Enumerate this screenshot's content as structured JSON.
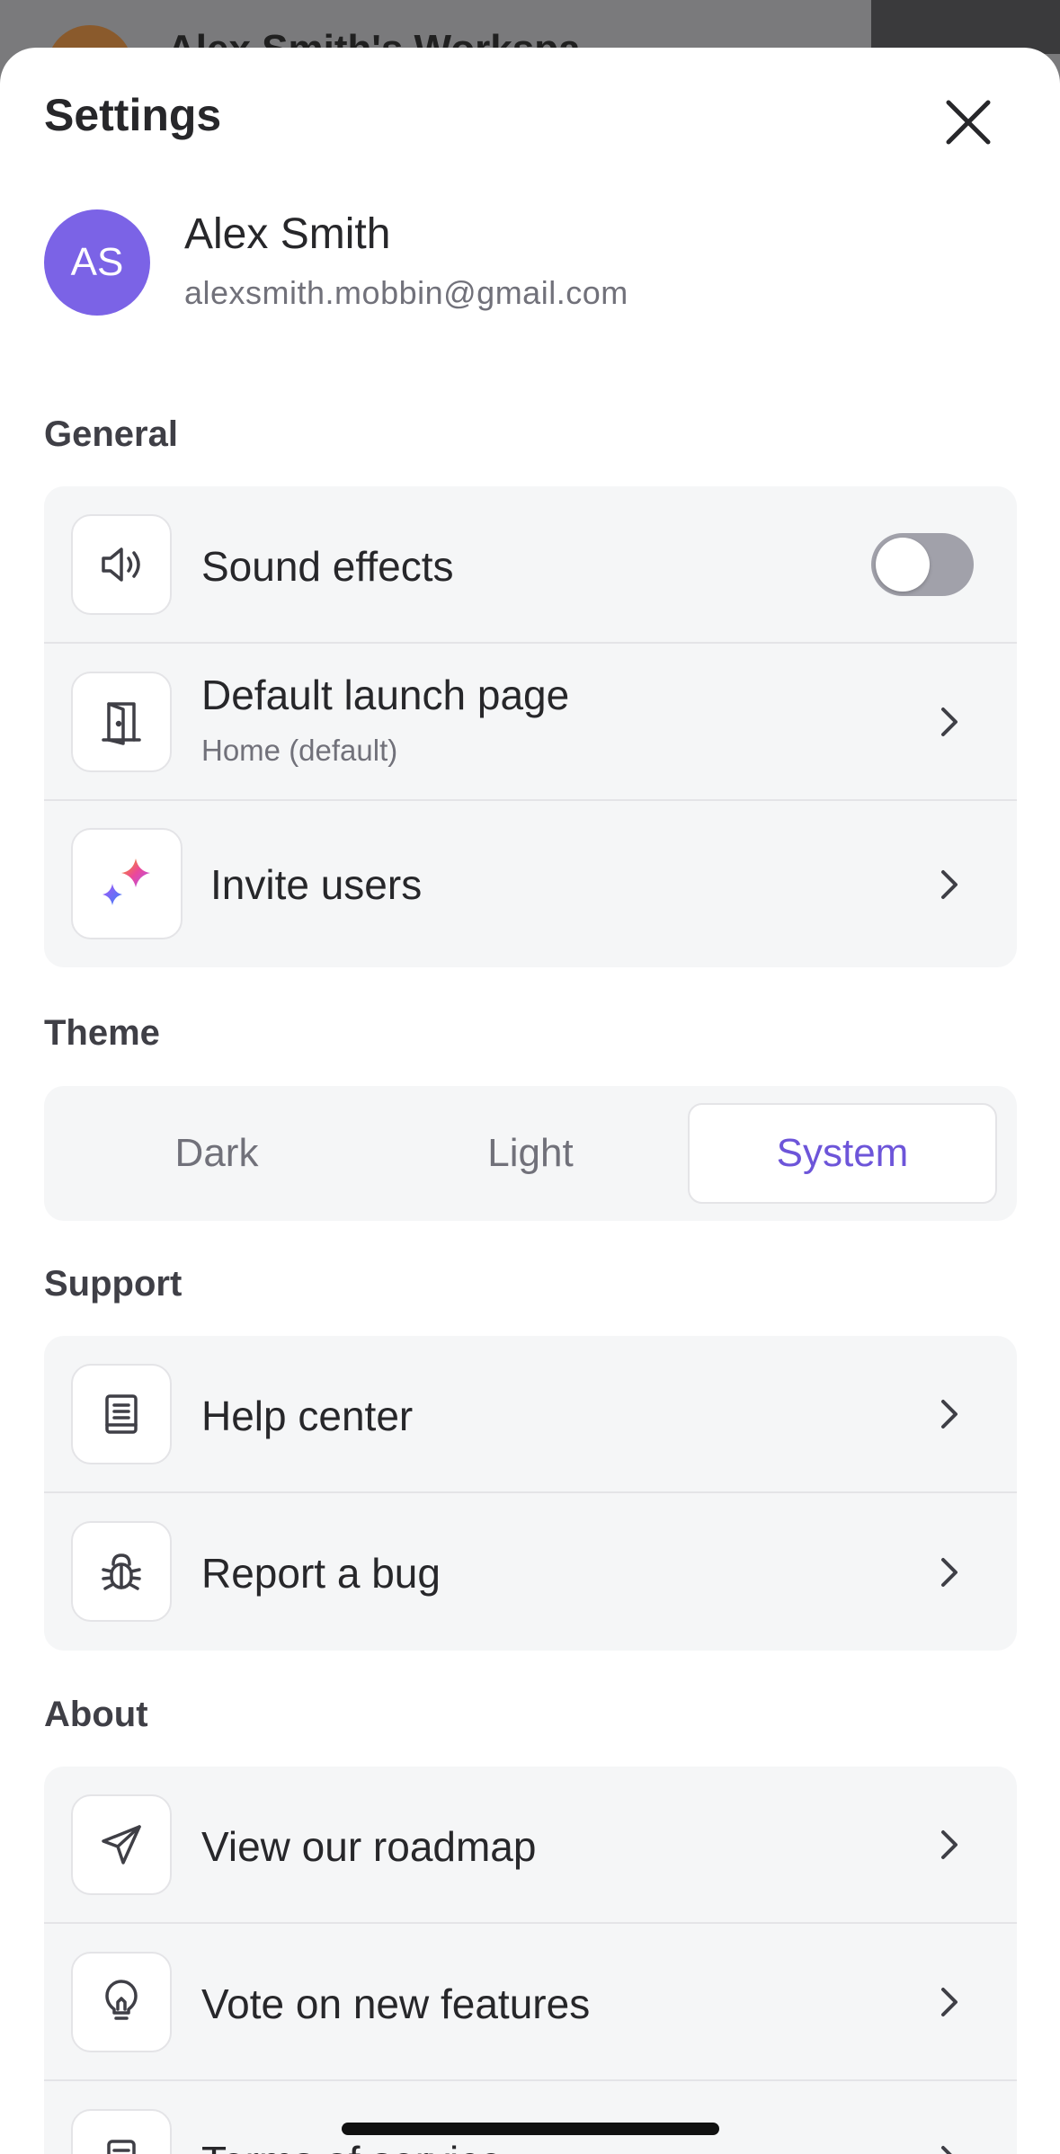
{
  "background": {
    "workspace_title": "Alex Smith's Workspa..."
  },
  "header": {
    "title": "Settings"
  },
  "profile": {
    "initials": "AS",
    "name": "Alex Smith",
    "email": "alexsmith.mobbin@gmail.com",
    "avatar_color": "#7b63e6"
  },
  "general": {
    "label": "General",
    "items": [
      {
        "label": "Sound effects",
        "icon": "speaker-icon",
        "control": "toggle",
        "toggle_on": false
      },
      {
        "label": "Default launch page",
        "sublabel": "Home (default)",
        "icon": "door-icon"
      },
      {
        "label": "Invite users",
        "icon": "sparkle-icon"
      }
    ]
  },
  "theme": {
    "label": "Theme",
    "options": [
      "Dark",
      "Light",
      "System"
    ],
    "selected": "System",
    "accent": "#6d55d9"
  },
  "support": {
    "label": "Support",
    "items": [
      {
        "label": "Help center",
        "icon": "book-icon"
      },
      {
        "label": "Report a bug",
        "icon": "bug-icon"
      }
    ]
  },
  "about": {
    "label": "About",
    "items": [
      {
        "label": "View our roadmap",
        "icon": "paper-plane-icon"
      },
      {
        "label": "Vote on new features",
        "icon": "lightbulb-icon"
      },
      {
        "label": "Terms of service",
        "icon": "document-icon"
      }
    ]
  }
}
